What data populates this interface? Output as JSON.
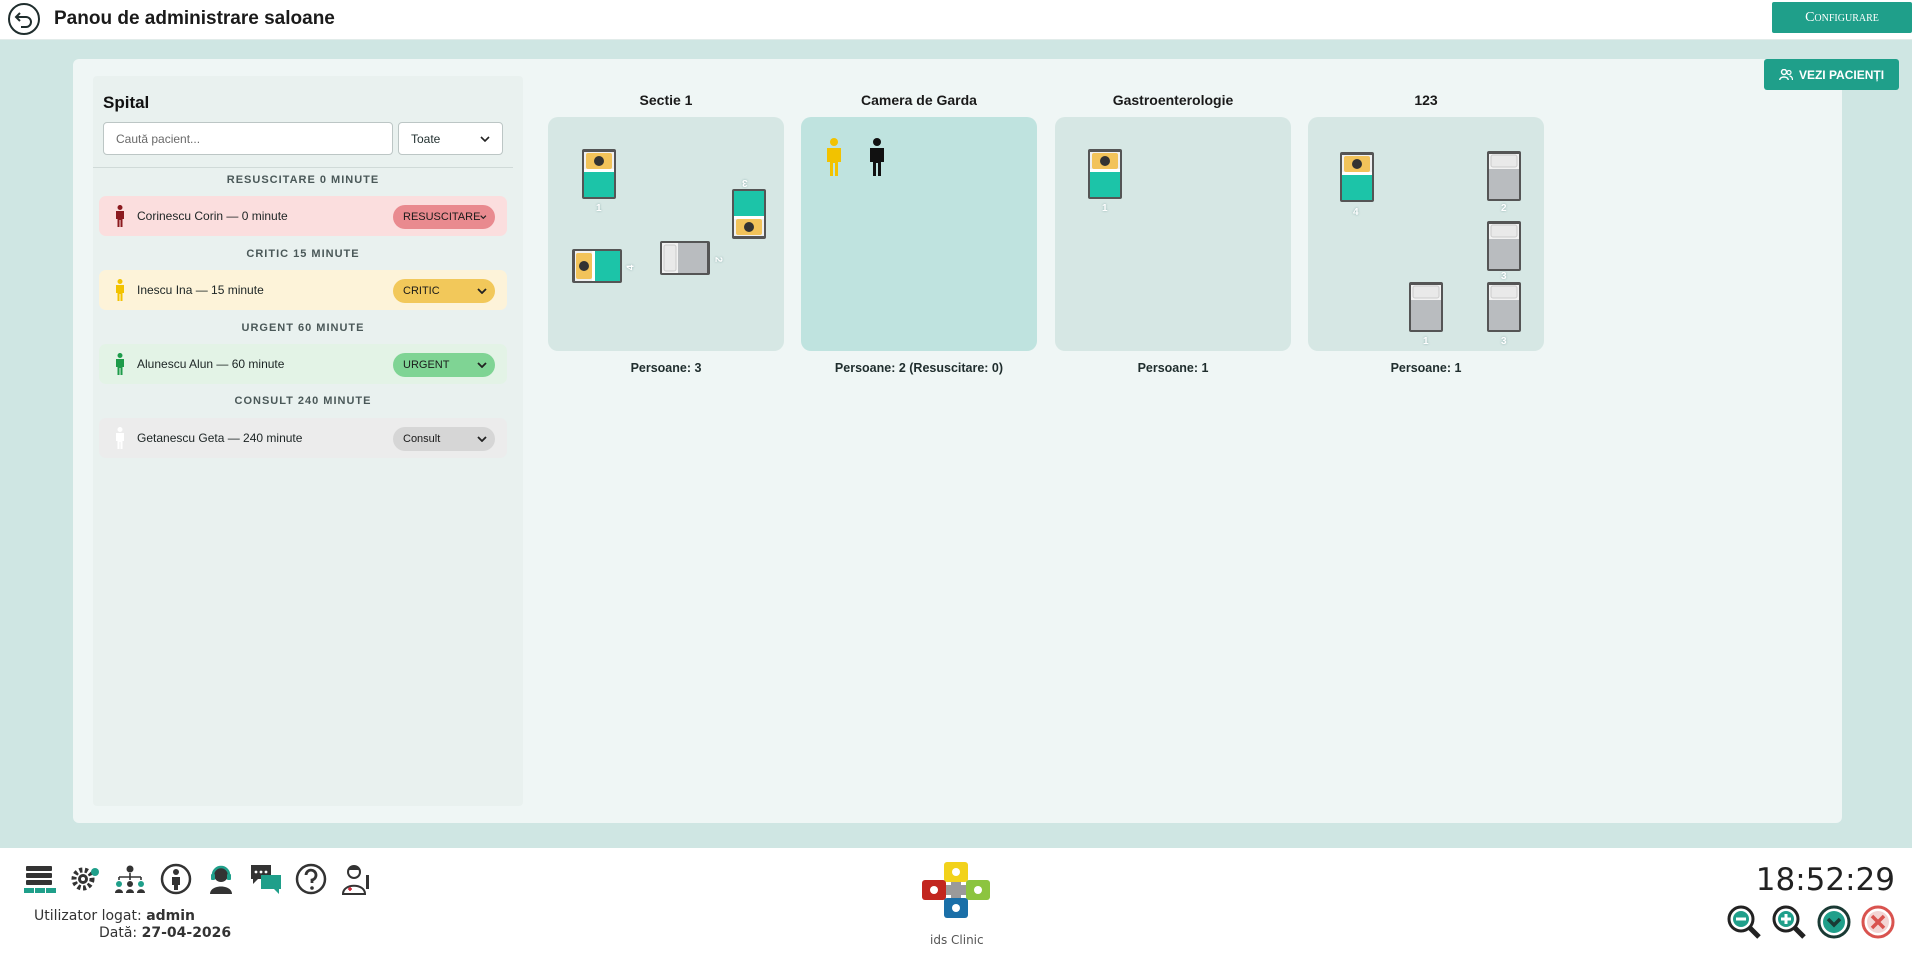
{
  "header": {
    "title": "Panou de administrare saloane",
    "configure_label": "Configurare"
  },
  "main": {
    "view_patients_label": "VEZI PACIENȚI"
  },
  "sidebar": {
    "title": "Spital",
    "search_placeholder": "Caută pacient...",
    "filter_value": "Toate",
    "groups": [
      {
        "header": "RESUSCITARE 0 MINUTE",
        "patient": "Corinescu Corin — 0 minute",
        "status": "RESUSCITARE",
        "row_color": "#fbdede",
        "pill_color": "#e98a8f",
        "icon_color": "#8b1a1f"
      },
      {
        "header": "CRITIC 15 MINUTE",
        "patient": "Inescu Ina — 15 minute",
        "status": "CRITIC",
        "row_color": "#fdf3d9",
        "pill_color": "#f2c85a",
        "icon_color": "#f2c200"
      },
      {
        "header": "URGENT 60 MINUTE",
        "patient": "Alunescu Alun — 60 minute",
        "status": "URGENT",
        "row_color": "#e3f3e6",
        "pill_color": "#7fd494",
        "icon_color": "#1e9b4a"
      },
      {
        "header": "CONSULT 240 MINUTE",
        "patient": "Getanescu Geta — 240 minute",
        "status": "Consult",
        "row_color": "#ececec",
        "pill_color": "#d6d6d6",
        "icon_color": "#ffffff"
      }
    ]
  },
  "rooms": [
    {
      "name": "Sectie 1",
      "count": "Persoane: 3",
      "beds": [
        "1",
        "2",
        "3",
        "4"
      ]
    },
    {
      "name": "Camera de Garda",
      "count": "Persoane: 2 (Resuscitare: 0)",
      "person_colors": [
        "#f2c200",
        "#111111"
      ]
    },
    {
      "name": "Gastroenterologie",
      "count": "Persoane: 1",
      "beds": [
        "1"
      ]
    },
    {
      "name": "123",
      "count": "Persoane: 1",
      "beds": [
        "4",
        "2",
        "3",
        "1",
        "3"
      ]
    }
  ],
  "footer": {
    "user_label": "Utilizator logat:",
    "user": "admin",
    "date_label": "Dată:",
    "date": "27-04-2026",
    "clock": "18:52:29",
    "logo_text": "ids Clinic",
    "icons": [
      "network-icon",
      "settings-icon",
      "org-chart-icon",
      "person-info-icon",
      "support-agent-icon",
      "chat-icon",
      "help-icon",
      "doctor-icon"
    ]
  },
  "colors": {
    "accent": "#1f9f8a",
    "bed_occupied": "#1cc4a8",
    "bed_empty": "#b9bcbf"
  }
}
